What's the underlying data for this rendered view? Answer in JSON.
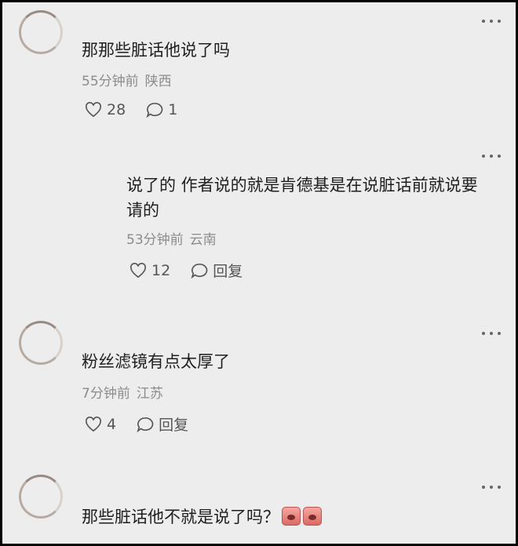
{
  "comments": [
    {
      "text": "那那些脏话他说了吗",
      "time": "55分钟前",
      "location": "陕西",
      "likes": "28",
      "replies": "1"
    },
    {
      "text_line1": "说了的 作者说的就是肯德基是在说脏话前就说要",
      "text_line2": "请的",
      "time": "53分钟前",
      "location": "云南",
      "likes": "12",
      "reply_label": "回复"
    },
    {
      "text": "粉丝滤镜有点太厚了",
      "time": "7分钟前",
      "location": "江苏",
      "likes": "4",
      "reply_label": "回复"
    },
    {
      "text": "那些脏话他不就是说了吗？"
    }
  ],
  "icons": {
    "more": "more-dots-icon",
    "like": "heart-icon",
    "comment": "speech-bubble-icon",
    "emoji": "crying-emoji-icon"
  },
  "colors": {
    "background": "#ededed",
    "text": "#1f1f1f",
    "meta": "#8c8c8c"
  }
}
